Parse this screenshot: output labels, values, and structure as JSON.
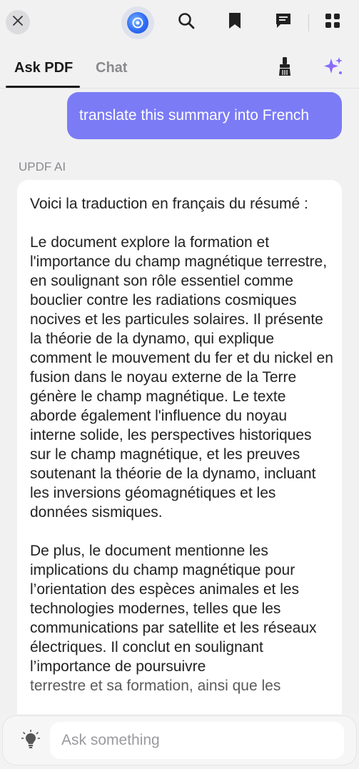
{
  "toolbar": {
    "close_icon": "close-icon",
    "ai_logo_icon": "updf-ai-logo-icon",
    "search_icon": "search-icon",
    "bookmark_icon": "bookmark-icon",
    "comment_icon": "comment-icon",
    "grid_icon": "grid-icon"
  },
  "tabs": [
    {
      "label": "Ask PDF",
      "active": true
    },
    {
      "label": "Chat",
      "active": false
    }
  ],
  "actions": {
    "clear_icon": "broom-icon",
    "prompt_icon": "sparkle-icon"
  },
  "conversation": {
    "user_message": "translate this summary into French",
    "ai_name": "UPDF AI",
    "ai_paragraphs": [
      "Voici la traduction en français du résumé :",
      "Le document explore la formation et l'importance du champ magnétique terrestre, en soulignant son rôle essentiel comme bouclier contre les radiations cosmiques nocives et les particules solaires. Il présente la théorie de la dynamo, qui explique comment le mouvement du fer et du nickel en fusion dans le noyau externe de la Terre génère le champ magnétique. Le texte aborde également l'influence du noyau interne solide, les perspectives historiques sur le champ magnétique, et les preuves soutenant la théorie de la dynamo, incluant les inversions géomagnétiques et les données sismiques.",
      "De plus, le document mentionne les implications du champ magnétique pour l’orientation des espèces animales et les technologies modernes, telles que les communications par satellite et les réseaux électriques. Il conclut en soulignant l’importance de poursuivre"
    ],
    "ai_partial_line": "terrestre et sa formation, ainsi que les"
  },
  "input": {
    "placeholder": "Ask something",
    "value": "",
    "hint_icon": "lightbulb-icon"
  },
  "colors": {
    "accent": "#7b7bf6",
    "background": "#f1f1f2",
    "card": "#ffffff"
  }
}
